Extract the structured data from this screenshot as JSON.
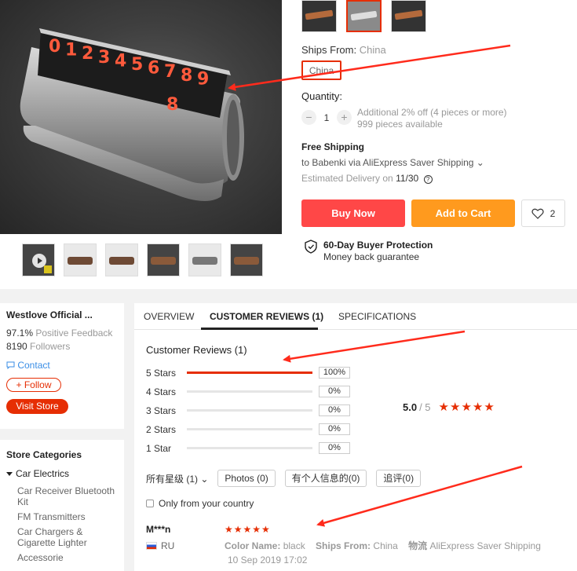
{
  "product": {
    "plate_digits": "0123456789",
    "digits_row_2": "8",
    "sku_thumbs": [
      "variant-1",
      "variant-2",
      "variant-3"
    ],
    "gallery_thumbs": [
      "video",
      "image-2",
      "image-3",
      "image-4",
      "image-5",
      "image-6"
    ]
  },
  "options": {
    "ships_from_label": "Ships From:",
    "ships_from_value": "China",
    "chip_label": "China"
  },
  "quantity": {
    "label": "Quantity:",
    "minus": "−",
    "value": "1",
    "plus": "+",
    "discount": "Additional 2% off (4 pieces or more)",
    "available": "999 pieces available"
  },
  "shipping": {
    "title": "Free Shipping",
    "to_text": "to Babenki via AliExpress Saver Shipping ⌄",
    "eta_prefix": "Estimated Delivery on",
    "eta_date": "11/30",
    "help": "?"
  },
  "actions": {
    "buy_now": "Buy Now",
    "add_to_cart": "Add to Cart",
    "wish_count": "2"
  },
  "protection": {
    "title": "60-Day Buyer Protection",
    "subtitle": "Money back guarantee"
  },
  "store": {
    "name": "Westlove Official ...",
    "feedback_value": "97.1%",
    "feedback_label": "Positive Feedback",
    "followers_value": "8190",
    "followers_label": "Followers",
    "contact": "Contact",
    "follow": "+ Follow",
    "visit": "Visit Store"
  },
  "categories": {
    "title": "Store Categories",
    "main": "Car Electrics",
    "items": [
      "Car Receiver Bluetooth Kit",
      "FM Transmitters",
      "Car Chargers & Cigarette Lighter",
      "Accessorie"
    ]
  },
  "tabs": {
    "overview": "OVERVIEW",
    "reviews": "CUSTOMER REVIEWS (1)",
    "specs": "SPECIFICATIONS"
  },
  "reviews": {
    "title": "Customer Reviews (1)",
    "breakdown": [
      {
        "label": "5 Stars",
        "pct": "100%",
        "fraction": 1.0
      },
      {
        "label": "4 Stars",
        "pct": "0%",
        "fraction": 0
      },
      {
        "label": "3 Stars",
        "pct": "0%",
        "fraction": 0
      },
      {
        "label": "2 Stars",
        "pct": "0%",
        "fraction": 0
      },
      {
        "label": "1 Star",
        "pct": "0%",
        "fraction": 0
      }
    ],
    "average": "5.0",
    "average_suffix": "/ 5",
    "average_stars": "★★★★★",
    "sort_label": "所有星级 (1) ⌄",
    "filter_photos": "Photos (0)",
    "filter_personal": "有个人信息的(0)",
    "filter_addl": "追评(0)",
    "only_country": "Only from your country",
    "items": [
      {
        "user": "M***n",
        "country": "RU",
        "stars": "★★★★★",
        "color_key": "Color Name:",
        "color_val": "black",
        "ships_key": "Ships From:",
        "ships_val": "China",
        "logistics_key": "物流",
        "logistics_val": "AliExpress Saver Shipping",
        "date": "10 Sep 2019 17:02"
      }
    ]
  },
  "colors": {
    "accent_red": "#e62e04",
    "buy_now": "#ff4747",
    "add_to_cart": "#ff9a1e",
    "annotation_arrow": "#ff2b1c"
  }
}
